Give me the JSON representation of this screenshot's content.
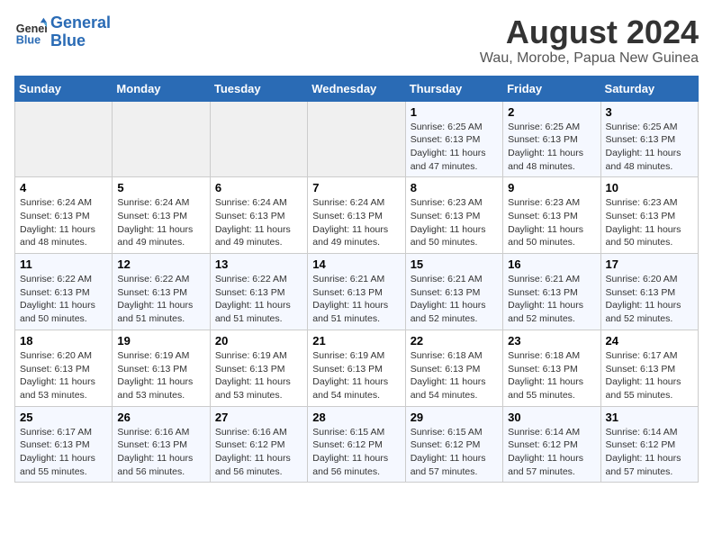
{
  "logo": {
    "line1": "General",
    "line2": "Blue"
  },
  "title": "August 2024",
  "subtitle": "Wau, Morobe, Papua New Guinea",
  "days_of_week": [
    "Sunday",
    "Monday",
    "Tuesday",
    "Wednesday",
    "Thursday",
    "Friday",
    "Saturday"
  ],
  "weeks": [
    [
      {
        "num": "",
        "info": ""
      },
      {
        "num": "",
        "info": ""
      },
      {
        "num": "",
        "info": ""
      },
      {
        "num": "",
        "info": ""
      },
      {
        "num": "1",
        "info": "Sunrise: 6:25 AM\nSunset: 6:13 PM\nDaylight: 11 hours and 47 minutes."
      },
      {
        "num": "2",
        "info": "Sunrise: 6:25 AM\nSunset: 6:13 PM\nDaylight: 11 hours and 48 minutes."
      },
      {
        "num": "3",
        "info": "Sunrise: 6:25 AM\nSunset: 6:13 PM\nDaylight: 11 hours and 48 minutes."
      }
    ],
    [
      {
        "num": "4",
        "info": "Sunrise: 6:24 AM\nSunset: 6:13 PM\nDaylight: 11 hours and 48 minutes."
      },
      {
        "num": "5",
        "info": "Sunrise: 6:24 AM\nSunset: 6:13 PM\nDaylight: 11 hours and 49 minutes."
      },
      {
        "num": "6",
        "info": "Sunrise: 6:24 AM\nSunset: 6:13 PM\nDaylight: 11 hours and 49 minutes."
      },
      {
        "num": "7",
        "info": "Sunrise: 6:24 AM\nSunset: 6:13 PM\nDaylight: 11 hours and 49 minutes."
      },
      {
        "num": "8",
        "info": "Sunrise: 6:23 AM\nSunset: 6:13 PM\nDaylight: 11 hours and 50 minutes."
      },
      {
        "num": "9",
        "info": "Sunrise: 6:23 AM\nSunset: 6:13 PM\nDaylight: 11 hours and 50 minutes."
      },
      {
        "num": "10",
        "info": "Sunrise: 6:23 AM\nSunset: 6:13 PM\nDaylight: 11 hours and 50 minutes."
      }
    ],
    [
      {
        "num": "11",
        "info": "Sunrise: 6:22 AM\nSunset: 6:13 PM\nDaylight: 11 hours and 50 minutes."
      },
      {
        "num": "12",
        "info": "Sunrise: 6:22 AM\nSunset: 6:13 PM\nDaylight: 11 hours and 51 minutes."
      },
      {
        "num": "13",
        "info": "Sunrise: 6:22 AM\nSunset: 6:13 PM\nDaylight: 11 hours and 51 minutes."
      },
      {
        "num": "14",
        "info": "Sunrise: 6:21 AM\nSunset: 6:13 PM\nDaylight: 11 hours and 51 minutes."
      },
      {
        "num": "15",
        "info": "Sunrise: 6:21 AM\nSunset: 6:13 PM\nDaylight: 11 hours and 52 minutes."
      },
      {
        "num": "16",
        "info": "Sunrise: 6:21 AM\nSunset: 6:13 PM\nDaylight: 11 hours and 52 minutes."
      },
      {
        "num": "17",
        "info": "Sunrise: 6:20 AM\nSunset: 6:13 PM\nDaylight: 11 hours and 52 minutes."
      }
    ],
    [
      {
        "num": "18",
        "info": "Sunrise: 6:20 AM\nSunset: 6:13 PM\nDaylight: 11 hours and 53 minutes."
      },
      {
        "num": "19",
        "info": "Sunrise: 6:19 AM\nSunset: 6:13 PM\nDaylight: 11 hours and 53 minutes."
      },
      {
        "num": "20",
        "info": "Sunrise: 6:19 AM\nSunset: 6:13 PM\nDaylight: 11 hours and 53 minutes."
      },
      {
        "num": "21",
        "info": "Sunrise: 6:19 AM\nSunset: 6:13 PM\nDaylight: 11 hours and 54 minutes."
      },
      {
        "num": "22",
        "info": "Sunrise: 6:18 AM\nSunset: 6:13 PM\nDaylight: 11 hours and 54 minutes."
      },
      {
        "num": "23",
        "info": "Sunrise: 6:18 AM\nSunset: 6:13 PM\nDaylight: 11 hours and 55 minutes."
      },
      {
        "num": "24",
        "info": "Sunrise: 6:17 AM\nSunset: 6:13 PM\nDaylight: 11 hours and 55 minutes."
      }
    ],
    [
      {
        "num": "25",
        "info": "Sunrise: 6:17 AM\nSunset: 6:13 PM\nDaylight: 11 hours and 55 minutes."
      },
      {
        "num": "26",
        "info": "Sunrise: 6:16 AM\nSunset: 6:13 PM\nDaylight: 11 hours and 56 minutes."
      },
      {
        "num": "27",
        "info": "Sunrise: 6:16 AM\nSunset: 6:12 PM\nDaylight: 11 hours and 56 minutes."
      },
      {
        "num": "28",
        "info": "Sunrise: 6:15 AM\nSunset: 6:12 PM\nDaylight: 11 hours and 56 minutes."
      },
      {
        "num": "29",
        "info": "Sunrise: 6:15 AM\nSunset: 6:12 PM\nDaylight: 11 hours and 57 minutes."
      },
      {
        "num": "30",
        "info": "Sunrise: 6:14 AM\nSunset: 6:12 PM\nDaylight: 11 hours and 57 minutes."
      },
      {
        "num": "31",
        "info": "Sunrise: 6:14 AM\nSunset: 6:12 PM\nDaylight: 11 hours and 57 minutes."
      }
    ]
  ]
}
